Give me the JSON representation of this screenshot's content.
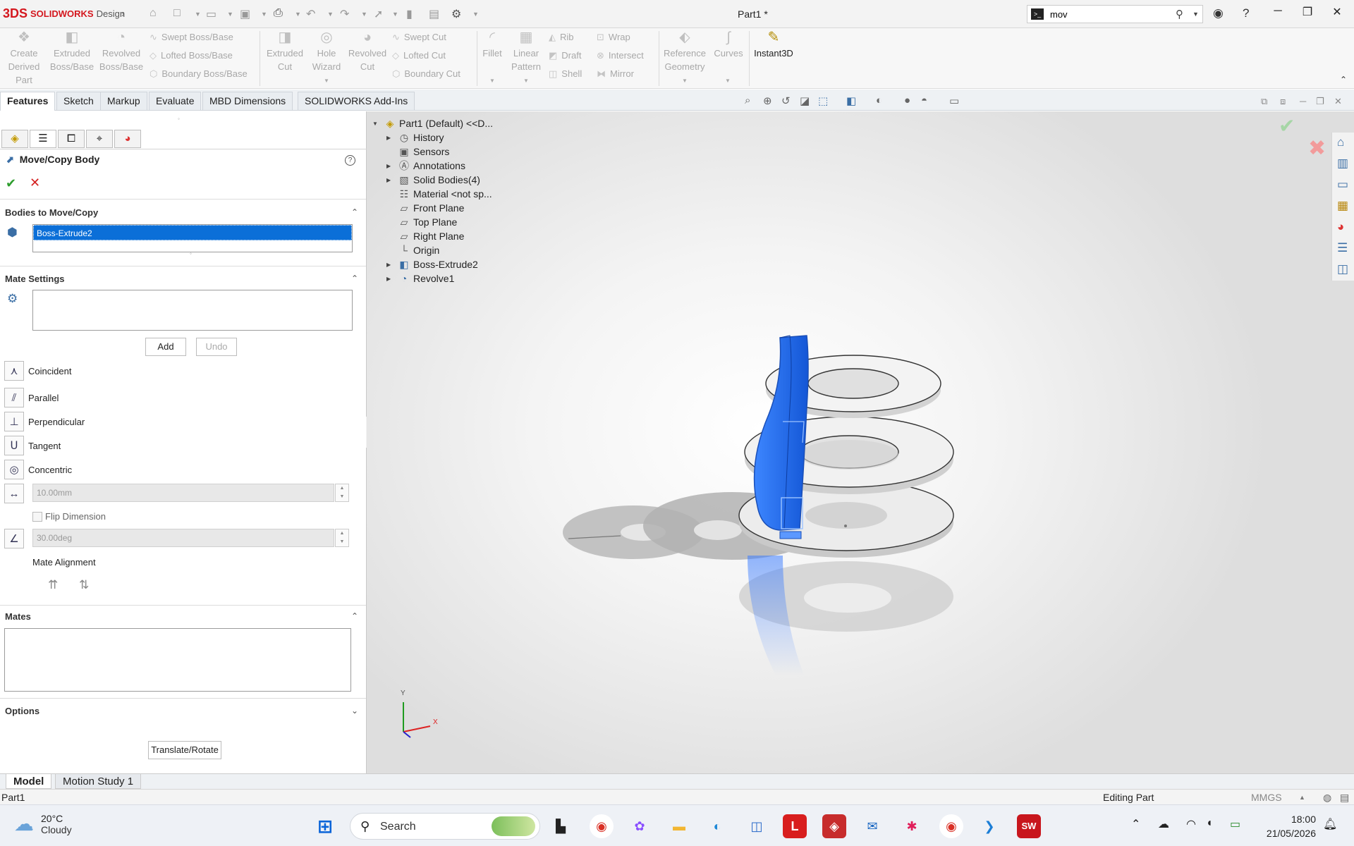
{
  "app": {
    "logo_mark": "3DS",
    "brand": "SOLIDWORKS",
    "brand_suffix": "Design",
    "document_title": "Part1 *"
  },
  "search": {
    "value": "mov",
    "cmd_glyph": ">_"
  },
  "ribbon": {
    "big_buttons": [
      {
        "label_line1": "Create",
        "label_line2": "Derived",
        "label_line3": "Part",
        "icon": "derived-part-icon"
      },
      {
        "label_line1": "Extruded",
        "label_line2": "Boss/Base",
        "icon": "extrude-icon"
      },
      {
        "label_line1": "Revolved",
        "label_line2": "Boss/Base",
        "icon": "revolve-icon"
      },
      {
        "label_line1": "Extruded",
        "label_line2": "Cut",
        "icon": "extrude-cut-icon"
      },
      {
        "label_line1": "Hole",
        "label_line2": "Wizard",
        "icon": "hole-wizard-icon"
      },
      {
        "label_line1": "Revolved",
        "label_line2": "Cut",
        "icon": "revolve-cut-icon"
      },
      {
        "label_line1": "Fillet",
        "icon": "fillet-icon"
      },
      {
        "label_line1": "Linear",
        "label_line2": "Pattern",
        "icon": "pattern-icon"
      },
      {
        "label_line1": "Reference",
        "label_line2": "Geometry",
        "icon": "reference-icon"
      },
      {
        "label_line1": "Curves",
        "icon": "curves-icon"
      },
      {
        "label_line1": "Instant3D",
        "icon": "instant3d-icon"
      }
    ],
    "small_buttons": {
      "swept_boss": "Swept Boss/Base",
      "lofted_boss": "Lofted Boss/Base",
      "boundary_boss": "Boundary Boss/Base",
      "swept_cut": "Swept Cut",
      "lofted_cut": "Lofted Cut",
      "boundary_cut": "Boundary Cut",
      "rib": "Rib",
      "draft": "Draft",
      "shell": "Shell",
      "wrap": "Wrap",
      "intersect": "Intersect",
      "mirror": "Mirror"
    }
  },
  "command_tabs": [
    "Features",
    "Sketch",
    "Markup",
    "Evaluate",
    "MBD Dimensions",
    "SOLIDWORKS Add-Ins"
  ],
  "property_manager": {
    "title": "Move/Copy Body",
    "help": "?",
    "ok": "✔",
    "cancel": "✕",
    "sections": {
      "bodies": "Bodies to Move/Copy",
      "mate_settings": "Mate Settings",
      "mates": "Mates",
      "options": "Options"
    },
    "selected_body": "Boss-Extrude2",
    "add_button": "Add",
    "undo_button": "Undo",
    "mate_types": [
      "Coincident",
      "Parallel",
      "Perpendicular",
      "Tangent",
      "Concentric"
    ],
    "distance_value": "10.00mm",
    "flip_dimension": "Flip Dimension",
    "angle_value": "30.00deg",
    "mate_alignment": "Mate Alignment",
    "translate_rotate": "Translate/Rotate"
  },
  "feature_tree": [
    {
      "label": "Part1 (Default) <<D...",
      "icon": "part-icon",
      "expand": "▼"
    },
    {
      "label": "History",
      "icon": "history-icon",
      "expand": "▶"
    },
    {
      "label": "Sensors",
      "icon": "sensors-icon",
      "expand": ""
    },
    {
      "label": "Annotations",
      "icon": "annotations-icon",
      "expand": "▶"
    },
    {
      "label": "Solid Bodies(4)",
      "icon": "solid-bodies-icon",
      "expand": "▶"
    },
    {
      "label": "Material <not sp...",
      "icon": "material-icon",
      "expand": ""
    },
    {
      "label": "Front Plane",
      "icon": "plane-icon",
      "expand": ""
    },
    {
      "label": "Top Plane",
      "icon": "plane-icon",
      "expand": ""
    },
    {
      "label": "Right Plane",
      "icon": "plane-icon",
      "expand": ""
    },
    {
      "label": "Origin",
      "icon": "origin-icon",
      "expand": ""
    },
    {
      "label": "Boss-Extrude2",
      "icon": "extrude-feature-icon",
      "expand": "▶"
    },
    {
      "label": "Revolve1",
      "icon": "revolve-feature-icon",
      "expand": "▶"
    }
  ],
  "triad": {
    "x": "X",
    "y": "Y"
  },
  "bottom_tabs": [
    "Model",
    "Motion Study 1"
  ],
  "status": {
    "left": "Part1",
    "mode": "Editing Part",
    "units": "MMGS"
  },
  "taskbar": {
    "weather_temp": "20°C",
    "weather_desc": "Cloudy",
    "search_label": "Search",
    "time": "18:00",
    "date": "21/05/2026"
  },
  "colors": {
    "selection_blue": "#0b6fd8",
    "body_blue": "#1e6ff0",
    "ok_green": "#2e9e2e",
    "cancel_red": "#d42020",
    "brand_red": "#d4171e"
  }
}
